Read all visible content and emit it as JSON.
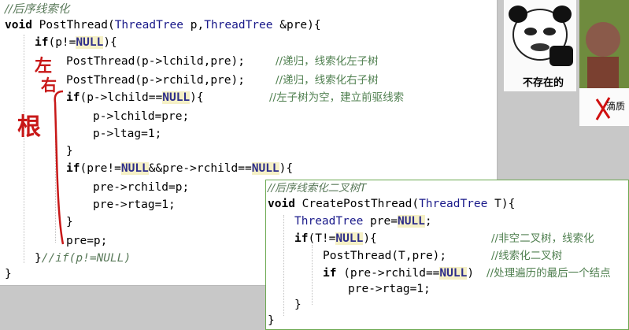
{
  "main": {
    "comment_title": "//后序线索化",
    "sig": {
      "kw": "void",
      "fn": " PostThread(",
      "t1": "ThreadTree",
      "p1": " p,",
      "t2": "ThreadTree",
      "p2": " &pre){"
    },
    "if1": {
      "kw": "if",
      "a": "(p!=",
      "null": "NULL",
      "b": "){"
    },
    "call1": {
      "code": "PostThread(p->lchild,pre);",
      "cmt": "//递归，线索化左子树"
    },
    "call2": {
      "code": "PostThread(p->rchild,pre);",
      "cmt": "//递归，线索化右子树"
    },
    "if2": {
      "kw": "if",
      "a": "(p->lchild==",
      "null": "NULL",
      "b": "){",
      "cmt": "//左子树为空，建立前驱线索"
    },
    "s1": "p->lchild=pre;",
    "s2": "p->ltag=1;",
    "close1": "}",
    "if3": {
      "kw": "if",
      "a": "(pre!=",
      "null1": "NULL",
      "b": "&&pre->rchild==",
      "null2": "NULL",
      "c": "){"
    },
    "s3": "pre->rchild=p;",
    "s4": "pre->rtag=1;",
    "close2": "}",
    "s5": "pre=p;",
    "close3": "}",
    "close3_cmt": "//if(p!=NULL)",
    "close4": "}"
  },
  "second": {
    "comment_title": "//后序线索化二叉树T",
    "sig": {
      "kw": "void",
      "fn": " CreatePostThread(",
      "t1": "ThreadTree",
      "p1": " T){"
    },
    "decl": {
      "t": "ThreadTree",
      "a": " pre=",
      "null": "NULL",
      "b": ";"
    },
    "if1": {
      "kw": "if",
      "a": "(T!=",
      "null": "NULL",
      "b": "){",
      "cmt": "//非空二叉树，线索化"
    },
    "call": {
      "code": "PostThread(T,pre);",
      "cmt": "//线索化二叉树"
    },
    "if2": {
      "kw": "if",
      "a": " (pre->rchild==",
      "null": "NULL",
      "b": ")",
      "cmt": "//处理遍历的最后一个结点"
    },
    "s1": "pre->rtag=1;",
    "close1": "}",
    "close2": "}"
  },
  "annotations": {
    "left": "左",
    "right": "右",
    "root": "根"
  },
  "memes": {
    "caption1": "不存在的",
    "caption2": "滴质"
  },
  "colors": {
    "keyword_highlight": "#f5f0c6",
    "comment": "#4f7f4f",
    "annotation": "#c81818",
    "panel_border": "#6aa84f"
  }
}
